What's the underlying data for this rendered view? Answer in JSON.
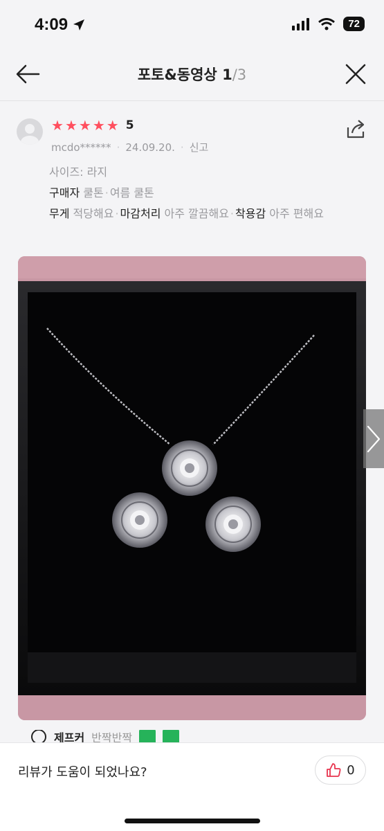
{
  "status": {
    "time": "4:09",
    "battery": "72"
  },
  "header": {
    "title": "포토&동영상",
    "page_current": "1",
    "page_rest": "/3"
  },
  "review": {
    "rating": "5",
    "stars": 5,
    "nickname": "mcdo******",
    "date": "24.09.20.",
    "report": "신고",
    "size_label": "사이즈: 라지",
    "buyer_label": "구매자",
    "buyer_values": [
      "쿨톤",
      "여름 쿨톤"
    ],
    "attributes": [
      {
        "label": "무게",
        "value": "적당해요"
      },
      {
        "label": "마감처리",
        "value": "아주 깔끔해요"
      },
      {
        "label": "착용감",
        "value": "아주 편해요"
      }
    ]
  },
  "partial": {
    "name": "제프커",
    "nick": "반짝반짝"
  },
  "footer": {
    "question": "리뷰가 도움이 되었나요?",
    "like_count": "0"
  },
  "colors": {
    "star": "#ff4f5e",
    "like_icon": "#e8344e",
    "background": "#f4f4f6"
  },
  "icons": [
    "back-arrow-icon",
    "close-icon",
    "share-icon",
    "thumbs-up-icon",
    "chevron-right-icon"
  ]
}
